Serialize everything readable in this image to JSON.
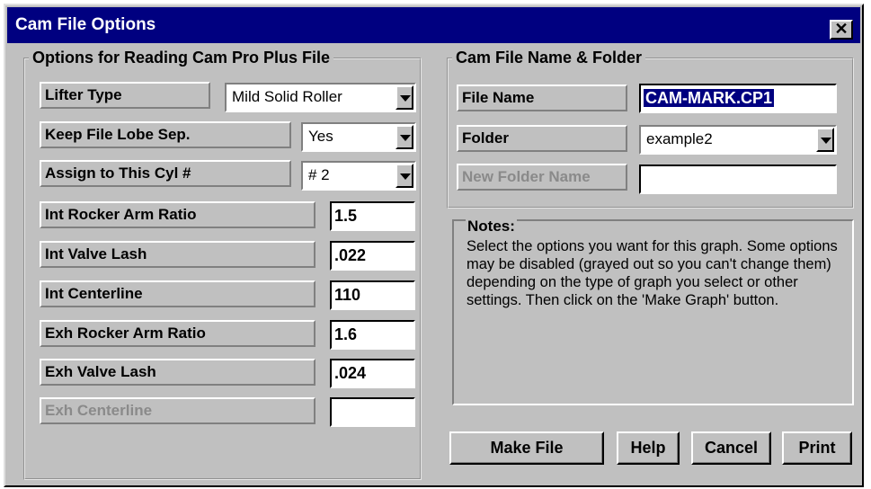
{
  "window": {
    "title": "Cam File Options"
  },
  "reading_options": {
    "legend": "Options for Reading Cam Pro Plus File",
    "lifter_type": {
      "label": "Lifter Type",
      "value": "Mild Solid Roller"
    },
    "keep_lobe_sep": {
      "label": "Keep File Lobe Sep.",
      "value": "Yes"
    },
    "assign_cyl": {
      "label": "Assign to This Cyl #",
      "value": "# 2"
    },
    "int_rocker": {
      "label": "Int Rocker Arm Ratio",
      "value": "1.5"
    },
    "int_lash": {
      "label": "Int Valve Lash",
      "value": ".022"
    },
    "int_centerline": {
      "label": "Int Centerline",
      "value": "110"
    },
    "exh_rocker": {
      "label": "Exh Rocker Arm Ratio",
      "value": "1.6"
    },
    "exh_lash": {
      "label": "Exh Valve Lash",
      "value": ".024"
    },
    "exh_centerline": {
      "label": "Exh Centerline",
      "value": ""
    }
  },
  "file_group": {
    "legend": "Cam File Name & Folder",
    "file_name": {
      "label": "File Name",
      "value": "CAM-MARK.CP1"
    },
    "folder": {
      "label": "Folder",
      "value": "example2"
    },
    "new_folder": {
      "label": "New Folder Name",
      "value": ""
    }
  },
  "notes": {
    "title": "Notes:",
    "text": "Select the options you want for this graph.  Some options may be disabled (grayed out so you can't change them) depending on the type of graph you select or other settings.  Then click on the 'Make Graph' button."
  },
  "buttons": {
    "make_file": "Make File",
    "help": "Help",
    "cancel": "Cancel",
    "print": "Print"
  },
  "colors": {
    "titlebar": "#000080",
    "face": "#c0c0c0",
    "disabled_text": "#8a8a8a"
  }
}
